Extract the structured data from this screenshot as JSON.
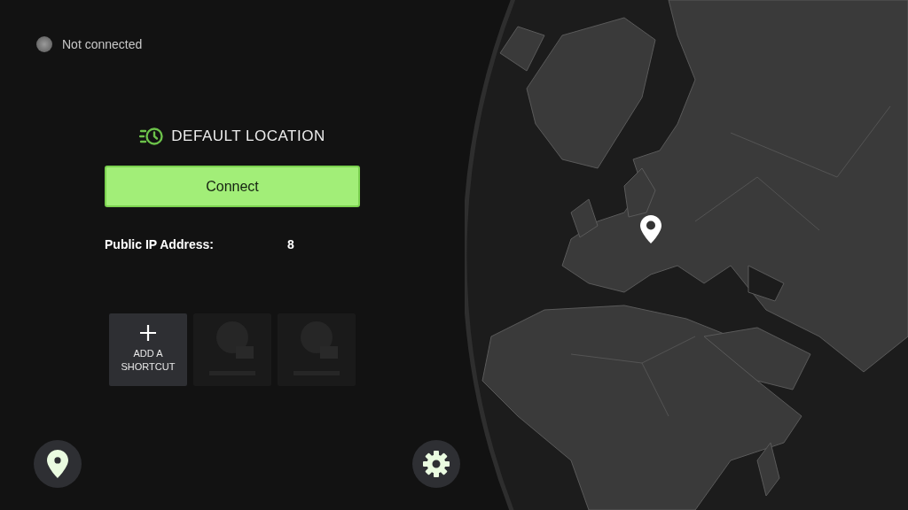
{
  "status": {
    "text": "Not connected",
    "connected": false
  },
  "location": {
    "label": "DEFAULT LOCATION"
  },
  "connect_button": {
    "label": "Connect"
  },
  "public_ip": {
    "label": "Public IP Address:",
    "value": "8"
  },
  "shortcuts": [
    {
      "kind": "add",
      "label": "ADD A SHORTCUT"
    },
    {
      "kind": "placeholder"
    },
    {
      "kind": "placeholder"
    }
  ]
}
